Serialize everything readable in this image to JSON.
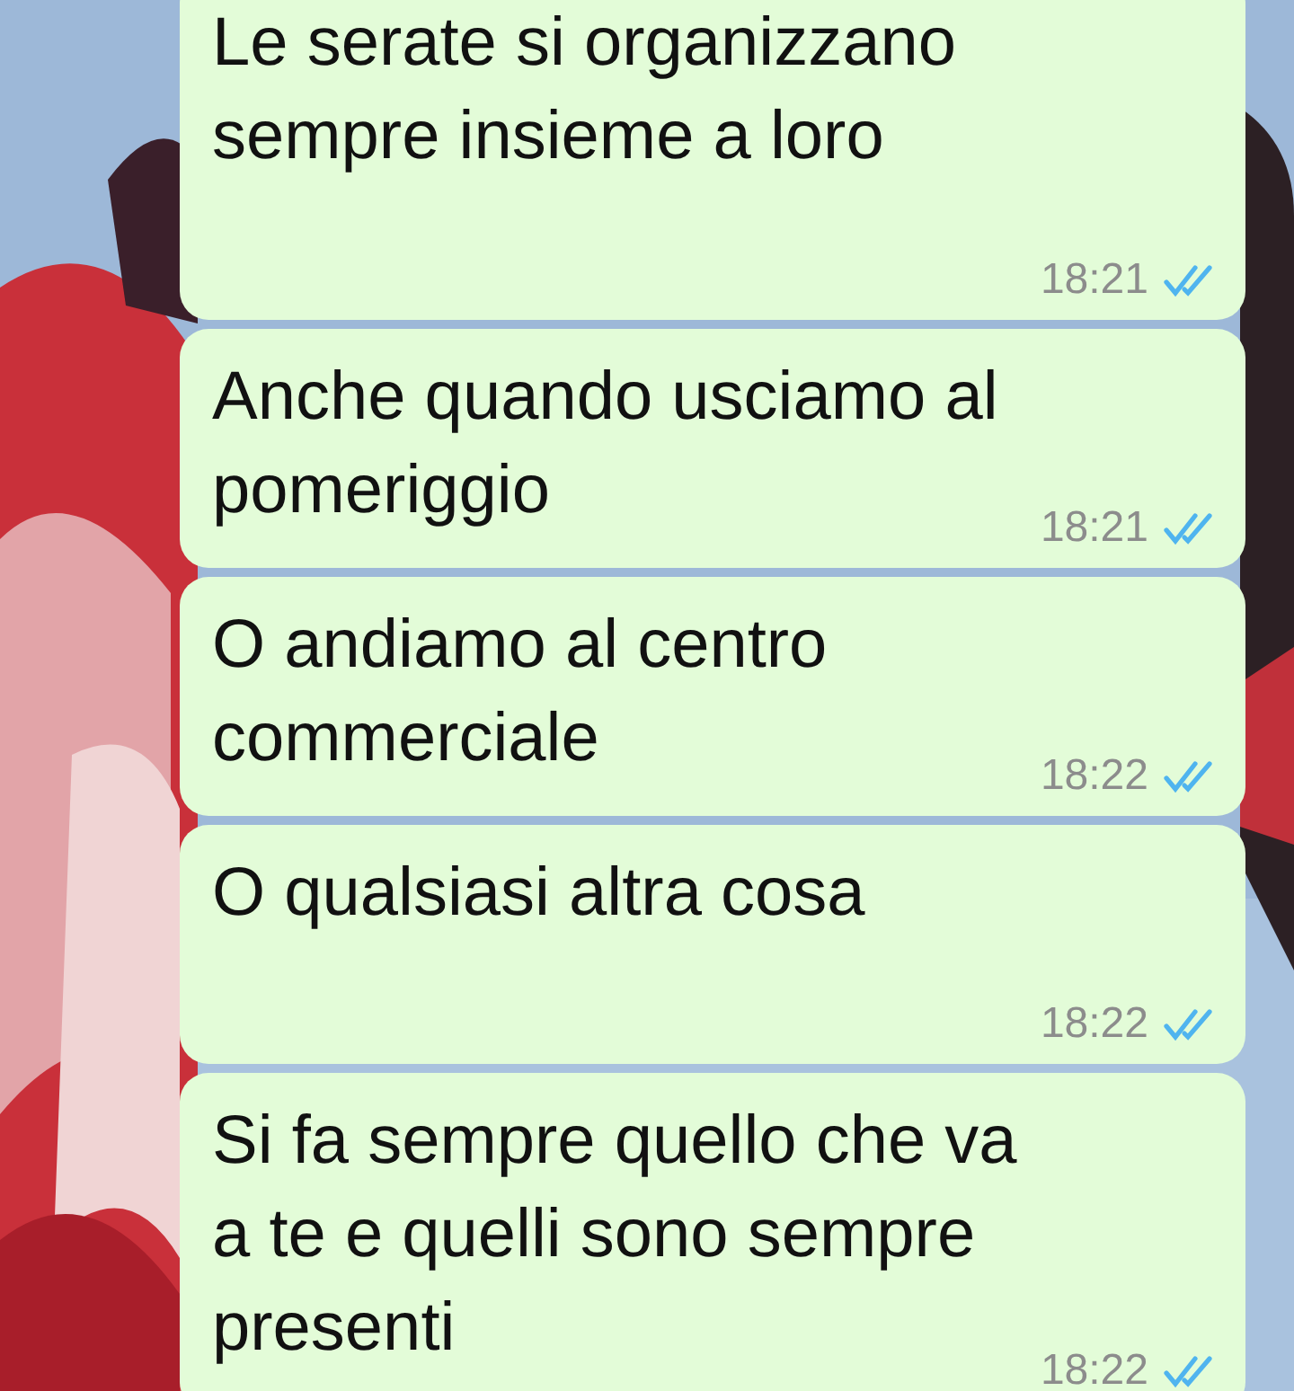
{
  "messages": [
    {
      "text": "Le serate si organizzano sempre insieme a loro",
      "time": "18:21",
      "read": true
    },
    {
      "text": "Anche quando usciamo al pomeriggio",
      "time": "18:21",
      "read": true
    },
    {
      "text": "O andiamo al centro commerciale",
      "time": "18:22",
      "read": true
    },
    {
      "text": "O qualsiasi altra cosa",
      "time": "18:22",
      "read": true
    },
    {
      "text": "Si fa sempre quello che va a te e quelli sono sempre presenti",
      "time": "18:22",
      "read": true
    }
  ]
}
